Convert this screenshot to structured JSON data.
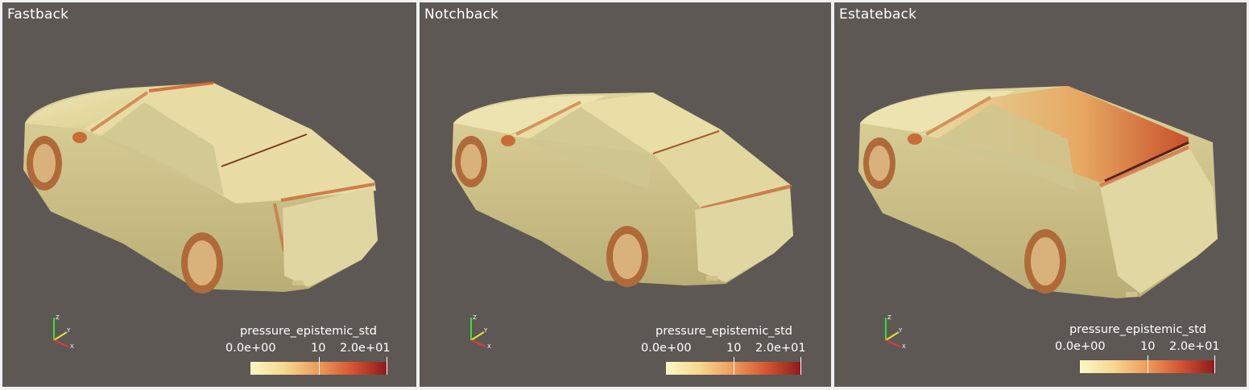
{
  "panels": [
    {
      "id": "fastback",
      "title": "Fastback",
      "colorbar": {
        "title": "pressure_epistemic_std",
        "min_label": "0.0e+00",
        "mid_label": "10",
        "max_label": "2.0e+01"
      },
      "axes_labels": {
        "z": "Z",
        "y": "Y",
        "x": "X"
      }
    },
    {
      "id": "notchback",
      "title": "Notchback",
      "colorbar": {
        "title": "pressure_epistemic_std",
        "min_label": "0.0e+00",
        "mid_label": "10",
        "max_label": "2.0e+01"
      },
      "axes_labels": {
        "z": "Z",
        "y": "Y",
        "x": "X"
      }
    },
    {
      "id": "estateback",
      "title": "Estateback",
      "colorbar": {
        "title": "pressure_epistemic_std",
        "min_label": "0.0e+00",
        "mid_label": "10",
        "max_label": "2.0e+01"
      },
      "axes_labels": {
        "z": "Z",
        "y": "Y",
        "x": "X"
      }
    }
  ],
  "colors": {
    "background": "#5e5855",
    "car_base": "#ece3a8",
    "colormap": [
      "#fbf7c7",
      "#f6d78e",
      "#ee9a5a",
      "#d35332",
      "#8c1a1b"
    ]
  }
}
